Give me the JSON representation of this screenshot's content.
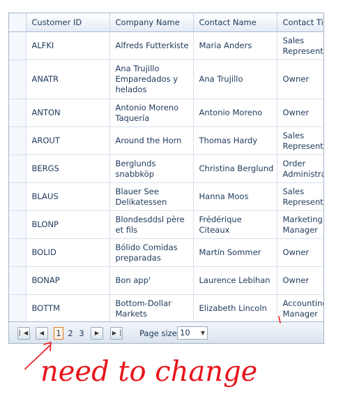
{
  "columns": [
    "",
    "Customer ID",
    "Company Name",
    "Contact Name",
    "Contact Title"
  ],
  "rows": [
    [
      "ALFKI",
      "Alfreds Futterkiste",
      "Maria Anders",
      "Sales Representative"
    ],
    [
      "ANATR",
      "Ana Trujillo Emparedados y helados",
      "Ana Trujillo",
      "Owner"
    ],
    [
      "ANTON",
      "Antonio Moreno Taquería",
      "Antonio Moreno",
      "Owner"
    ],
    [
      "AROUT",
      "Around the Horn",
      "Thomas Hardy",
      "Sales Representative"
    ],
    [
      "BERGS",
      "Berglunds snabbköp",
      "Christina Berglund",
      "Order Administrator"
    ],
    [
      "BLAUS",
      "Blauer See Delikatessen",
      "Hanna Moos",
      "Sales Representative"
    ],
    [
      "BLONP",
      "Blondesddsl père et fils",
      "Frédérique Citeaux",
      "Marketing Manager"
    ],
    [
      "BOLID",
      "Bólido Comidas preparadas",
      "Martín Sommer",
      "Owner"
    ],
    [
      "BONAP",
      "Bon app'",
      "Laurence Lebihan",
      "Owner"
    ],
    [
      "BOTTM",
      "Bottom-Dollar Markets",
      "Elizabeth Lincoln",
      "Accounting Manager"
    ]
  ],
  "pager": {
    "first_icon": "first-page-icon",
    "prev_icon": "prev-page-icon",
    "next_icon": "next-page-icon",
    "last_icon": "last-page-icon",
    "pages": [
      "1",
      "2",
      "3"
    ],
    "current_page": "1",
    "page_size_label": "Page size:",
    "page_size_value": "10"
  },
  "annotation": {
    "text": "need to change",
    "color": "#e8141b"
  }
}
